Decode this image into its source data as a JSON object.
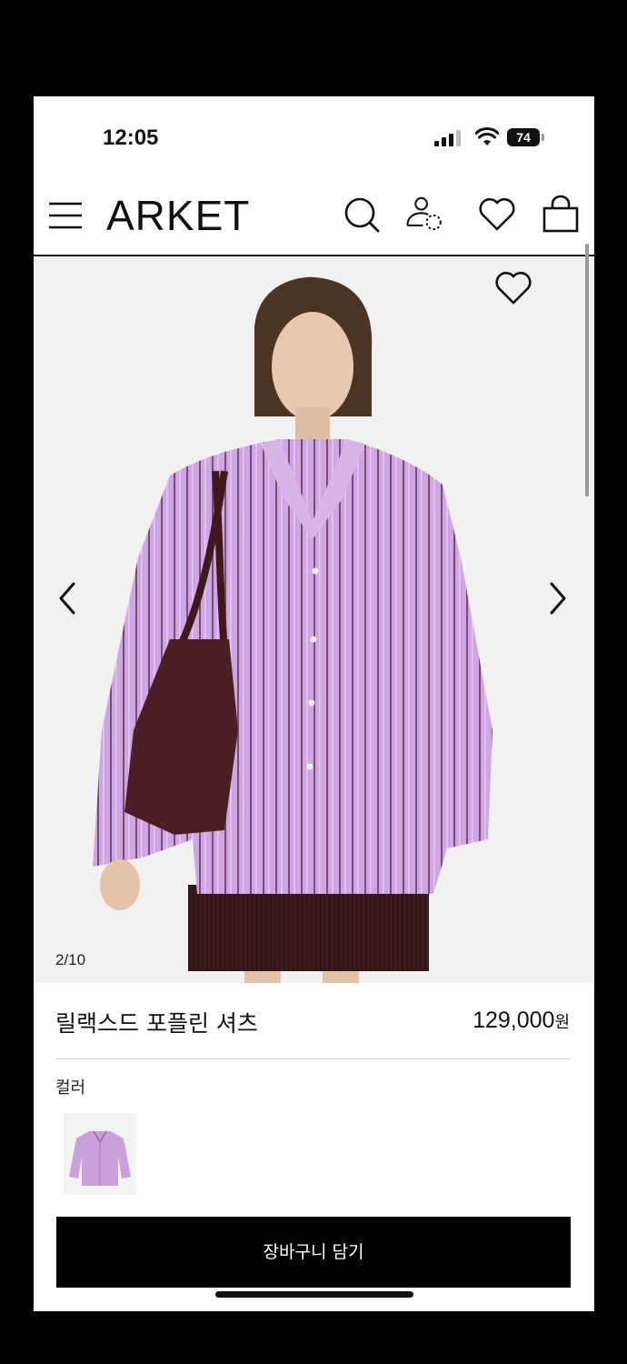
{
  "status_bar": {
    "time": "12:05",
    "battery": "74"
  },
  "header": {
    "logo": "ARKET"
  },
  "gallery": {
    "counter": "2/10"
  },
  "product": {
    "title": "릴랙스드 포플린 셔츠",
    "price": "129,000",
    "currency": "원",
    "color_label": "컬러"
  },
  "actions": {
    "add_to_cart": "장바구니 담기"
  },
  "colors": {
    "shirt": "#c9a3e0",
    "shirt_stripe": "#7d4d70",
    "bag": "#4a1e24",
    "skirt": "#3b1a1c",
    "background": "#f1f1f1"
  }
}
